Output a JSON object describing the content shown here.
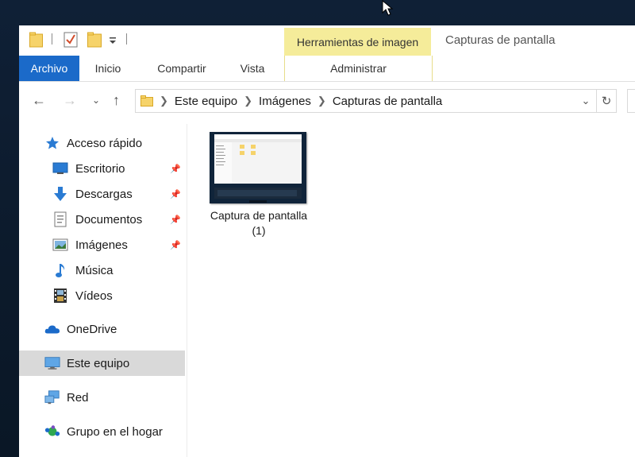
{
  "title_bar": {
    "context_tab": "Herramientas de imagen",
    "window_title": "Capturas de pantalla"
  },
  "ribbon_tabs": {
    "file": "Archivo",
    "home": "Inicio",
    "share": "Compartir",
    "view": "Vista",
    "manage": "Administrar"
  },
  "address": {
    "segments": [
      "Este equipo",
      "Imágenes",
      "Capturas de pantalla"
    ]
  },
  "sidebar": {
    "items": [
      {
        "label": "Acceso rápido",
        "icon": "star-icon"
      },
      {
        "label": "Escritorio",
        "icon": "desktop-icon",
        "pinned": true
      },
      {
        "label": "Descargas",
        "icon": "download-icon",
        "pinned": true
      },
      {
        "label": "Documentos",
        "icon": "document-icon",
        "pinned": true
      },
      {
        "label": "Imágenes",
        "icon": "pictures-icon",
        "pinned": true
      },
      {
        "label": "Música",
        "icon": "music-icon"
      },
      {
        "label": "Vídeos",
        "icon": "video-icon"
      },
      {
        "label": "OneDrive",
        "icon": "onedrive-icon"
      },
      {
        "label": "Este equipo",
        "icon": "computer-icon",
        "selected": true
      },
      {
        "label": "Red",
        "icon": "network-icon"
      },
      {
        "label": "Grupo en el hogar",
        "icon": "homegroup-icon"
      }
    ]
  },
  "files": [
    {
      "name": "Captura de pantalla (1)"
    }
  ],
  "colors": {
    "accent": "#1b6ac9",
    "context_tab": "#f5ec9a",
    "selected_row": "#d9d9d9"
  }
}
